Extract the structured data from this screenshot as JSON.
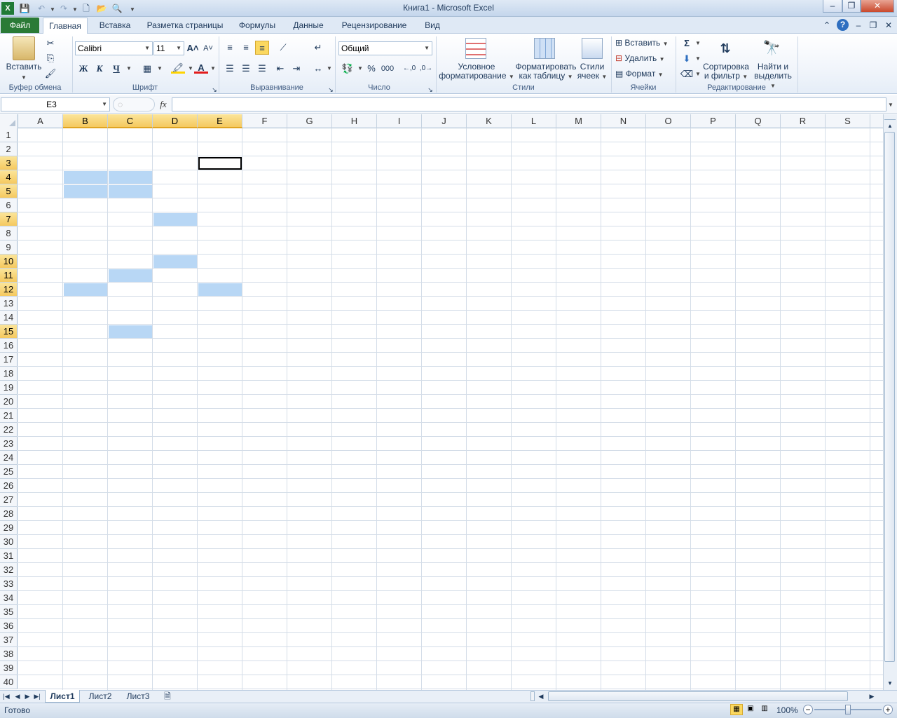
{
  "window": {
    "title": "Книга1  -  Microsoft Excel"
  },
  "tabs": [
    "Файл",
    "Главная",
    "Вставка",
    "Разметка страницы",
    "Формулы",
    "Данные",
    "Рецензирование",
    "Вид"
  ],
  "ribbon": {
    "clipboard": {
      "paste_label": "Вставить",
      "group": "Буфер обмена"
    },
    "font": {
      "name": "Calibri",
      "size": "11",
      "bold": "Ж",
      "italic": "К",
      "underline": "Ч",
      "group": "Шрифт"
    },
    "alignment": {
      "group": "Выравнивание"
    },
    "number": {
      "format": "Общий",
      "percent": "%",
      "thousands": "000",
      "group": "Число"
    },
    "styles": {
      "conditional_line1": "Условное",
      "conditional_line2": "форматирование",
      "table_line1": "Форматировать",
      "table_line2": "как таблицу",
      "cell_line1": "Стили",
      "cell_line2": "ячеек",
      "group": "Стили"
    },
    "cells": {
      "insert": "Вставить",
      "delete": "Удалить",
      "format": "Формат",
      "group": "Ячейки"
    },
    "editing": {
      "sort_line1": "Сортировка",
      "sort_line2": "и фильтр",
      "find_line1": "Найти и",
      "find_line2": "выделить",
      "group": "Редактирование"
    }
  },
  "formula_bar": {
    "name_box": "E3",
    "fx": "fx",
    "formula": ""
  },
  "grid": {
    "columns": [
      "A",
      "B",
      "C",
      "D",
      "E",
      "F",
      "G",
      "H",
      "I",
      "J",
      "K",
      "L",
      "M",
      "N",
      "O",
      "P",
      "Q",
      "R",
      "S"
    ],
    "selected_columns": [
      "B",
      "C",
      "D",
      "E"
    ],
    "row_count": 40,
    "selected_rows": [
      3,
      4,
      5,
      7,
      10,
      11,
      12,
      15
    ],
    "active_cell": "E3",
    "highlighted_cells": [
      "B4",
      "C4",
      "B5",
      "C5",
      "D7",
      "D10",
      "C11",
      "B12",
      "E12",
      "C15"
    ]
  },
  "sheets": [
    "Лист1",
    "Лист2",
    "Лист3"
  ],
  "active_sheet": "Лист1",
  "status": {
    "text": "Готово",
    "zoom": "100%"
  },
  "colors": {
    "file_tab": "#2a7a36",
    "selection_fill": "#b8d7f5",
    "header_highlight": "#f5c95f"
  }
}
